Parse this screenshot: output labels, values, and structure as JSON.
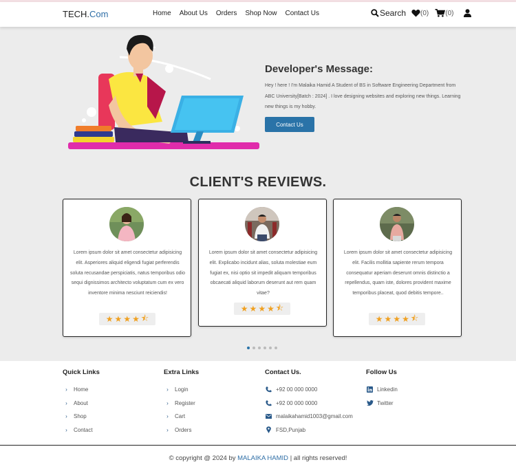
{
  "nav": {
    "brand_main": "TECH.",
    "brand_accent": "Com",
    "links": [
      "Home",
      "About Us",
      "Orders",
      "Shop Now",
      "Contact Us"
    ],
    "search_label": "Search",
    "wishlist_count": "(0)",
    "cart_count": "(0)"
  },
  "hero": {
    "title": "Developer's Message:",
    "text": "Hey ! here ! I'm Malaika Hamid A Student of BS in Software Engineering Department from ABC University[Batch : 2024] . I love designing websites and exploring new things. Learning new things is my hobby.",
    "button": "Contact Us"
  },
  "reviews": {
    "title": "CLIENT'S REVIEWS.",
    "cards": [
      {
        "text": "Lorem ipsum dolor sit amet consectetur adipisicing elit. Asperiores aliquid eligendi fugiat perferendis soluta recusandae perspiciatis, natus temporibus odio sequi dignissimos architecto voluptatum cum ex vero inventore minima nesciunt reiciendis!",
        "rating": 4.5
      },
      {
        "text": "Lorem ipsum dolor sit amet consectetur adipisicing elit. Explicabo incidunt alias, soluta molestiae eum fugiat ex, nisi optio sit impedit aliquam temporibus obcaecati aliquid laborum deserunt aut rem quam vitae?",
        "rating": 4.5
      },
      {
        "text": "Lorem ipsum dolor sit amet consectetur adipisicing elit. Facilis mollitia sapiente rerum tempora consequatur aperiam deserunt omnis distinctio a repellendus, quam iste, dolores provident maxime temporibus placeat, quod debitis tempore..",
        "rating": 4.5
      }
    ],
    "pagination_count": 6,
    "active_page": 1
  },
  "footer": {
    "quick_links": {
      "title": "Quick Links",
      "items": [
        "Home",
        "About",
        "Shop",
        "Contact"
      ]
    },
    "extra_links": {
      "title": "Extra Links",
      "items": [
        "Login",
        "Register",
        "Cart",
        "Orders"
      ]
    },
    "contact": {
      "title": "Contact Us.",
      "phone1": "+92 00 000 0000",
      "phone2": "+92 00 000 0000",
      "email": "malaikahamid1003@gmail.com",
      "location": "FSD,Punjab"
    },
    "follow": {
      "title": "Follow Us",
      "items": [
        "Linkedin",
        "Twitter"
      ]
    },
    "copyright_prefix": "© copyright @ 2024 by",
    "copyright_name": "MALAIKA HAMID",
    "copyright_suffix": "| all rights reserved!"
  },
  "colors": {
    "accent": "#2a73a8",
    "star": "#f0a020",
    "hero_bg": "#ececec"
  }
}
